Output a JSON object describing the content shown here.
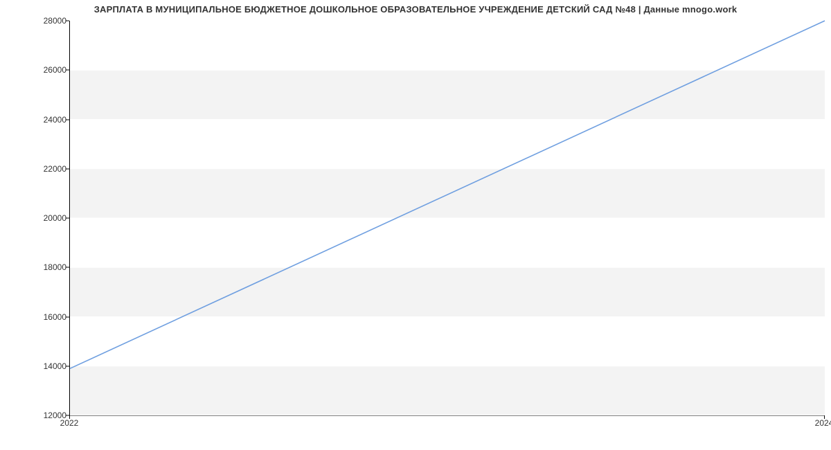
{
  "chart_data": {
    "type": "line",
    "title": "ЗАРПЛАТА В МУНИЦИПАЛЬНОЕ БЮДЖЕТНОЕ ДОШКОЛЬНОЕ ОБРАЗОВАТЕЛЬНОЕ УЧРЕЖДЕНИЕ ДЕТСКИЙ САД №48  | Данные mnogo.work",
    "x": [
      2022,
      2024
    ],
    "y": [
      13900,
      28000
    ],
    "xlabel": "",
    "ylabel": "",
    "xlim": [
      2022,
      2024
    ],
    "ylim": [
      12000,
      28000
    ],
    "x_ticks": [
      2022,
      2024
    ],
    "y_ticks": [
      12000,
      14000,
      16000,
      18000,
      20000,
      22000,
      24000,
      26000,
      28000
    ],
    "line_color": "#6f9fe0",
    "band_color": "#f3f3f3"
  }
}
